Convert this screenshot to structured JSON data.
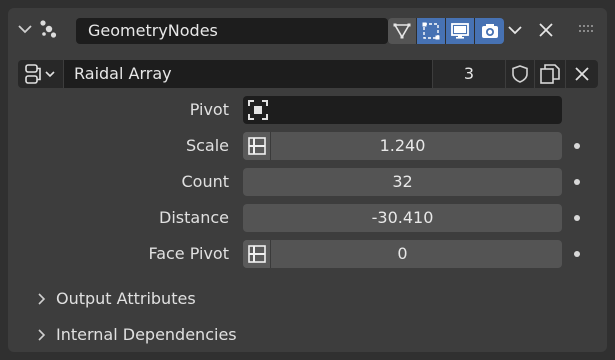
{
  "modifier": {
    "name": "GeometryNodes",
    "toggles": [
      {
        "icon": "edit-mode-icon",
        "active": false
      },
      {
        "icon": "on-cage-icon",
        "active": true
      },
      {
        "icon": "viewport-display-icon",
        "active": true
      },
      {
        "icon": "render-camera-icon",
        "active": true
      }
    ]
  },
  "node_group": {
    "name": "Raidal Array",
    "users": "3"
  },
  "properties": [
    {
      "label": "Pivot",
      "value": ""
    },
    {
      "label": "Scale",
      "value": "1.240"
    },
    {
      "label": "Count",
      "value": "32"
    },
    {
      "label": "Distance",
      "value": "-30.410"
    },
    {
      "label": "Face Pivot",
      "value": "0"
    }
  ],
  "subpanels": [
    {
      "label": "Output Attributes"
    },
    {
      "label": "Internal Dependencies"
    }
  ],
  "colors": {
    "panel_bg": "#3d3d3d",
    "field_bg": "#545454",
    "dark_field_bg": "#1d1d1d",
    "accent": "#4772b3"
  }
}
